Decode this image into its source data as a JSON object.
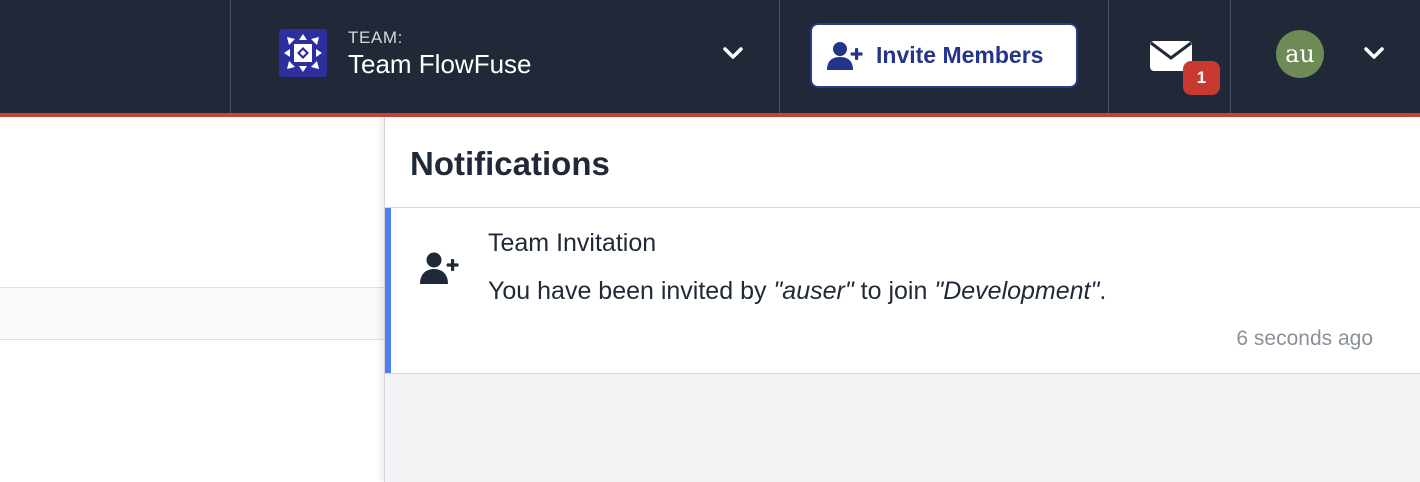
{
  "header": {
    "team_label": "TEAM:",
    "team_name": "Team FlowFuse",
    "invite_label": "Invite Members",
    "notification_count": "1",
    "avatar_initials": "au"
  },
  "notifications": {
    "title": "Notifications",
    "items": [
      {
        "icon": "user-plus-icon",
        "title": "Team Invitation",
        "body_prefix": "You have been invited by ",
        "inviter": "\"auser\"",
        "body_middle": " to join ",
        "team": "\"Development\"",
        "body_suffix": ".",
        "time": "6 seconds ago"
      }
    ]
  },
  "colors": {
    "header_bg": "#212838",
    "accent_red": "#c94436",
    "invite_blue": "#24348a",
    "notification_accent": "#4f7ef0",
    "badge_red": "#c83a30",
    "avatar_green": "#6e8b56"
  }
}
